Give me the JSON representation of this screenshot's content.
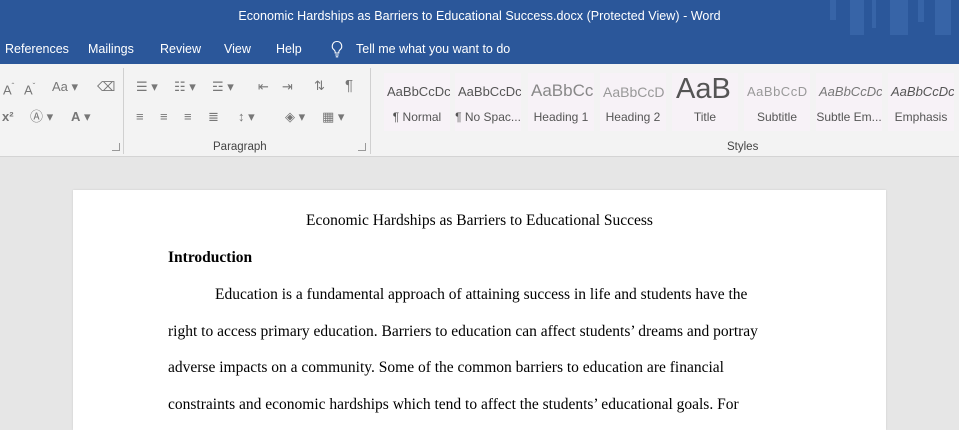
{
  "window": {
    "title": "Economic Hardships as Barriers to Educational Success.docx (Protected View)  -  Word"
  },
  "menu": {
    "tabs": [
      "References",
      "Mailings",
      "Review",
      "View",
      "Help"
    ],
    "tell_me": "Tell me what you want to do"
  },
  "ribbon": {
    "paragraph_group": "Paragraph",
    "styles_group": "Styles",
    "styles": [
      {
        "sample": "AaBbCcDc",
        "name": "¶ Normal"
      },
      {
        "sample": "AaBbCcDc",
        "name": "¶ No Spac..."
      },
      {
        "sample": "AaBbCc",
        "name": "Heading 1"
      },
      {
        "sample": "AaBbCcD",
        "name": "Heading 2"
      },
      {
        "sample": "AaB",
        "name": "Title"
      },
      {
        "sample": "AaBbCcD",
        "name": "Subtitle"
      },
      {
        "sample": "AaBbCcDc",
        "name": "Subtle Em..."
      },
      {
        "sample": "AaBbCcDc",
        "name": "Emphasis"
      }
    ]
  },
  "document": {
    "title": "Economic Hardships as Barriers to Educational Success",
    "heading": "Introduction",
    "lines": [
      "Education is a fundamental approach of attaining success in life and students have the",
      "right to access primary education. Barriers to education can affect students’ dreams and portray",
      "adverse impacts on a community. Some of the common barriers to education are financial",
      "constraints and economic hardships which tend to affect the students’ educational goals. For"
    ]
  },
  "colors": {
    "brand_blue": "#2b579a",
    "ribbon_bg": "#f3f3f3",
    "canvas_bg": "#e6e6e6"
  }
}
